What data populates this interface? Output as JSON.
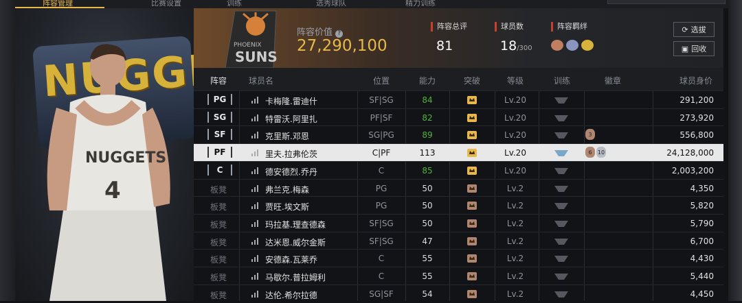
{
  "tabs": [
    "阵容管理",
    "比赛设置",
    "训练",
    "选秀球队",
    "精力训练"
  ],
  "team_logo_text": {
    "line1": "PHOENIX",
    "line2": "SUNS"
  },
  "lineup_value": {
    "label": "阵容价值",
    "value": "27,290,100"
  },
  "stats": {
    "rating": {
      "label": "阵容总评",
      "value": "81"
    },
    "roster": {
      "label": "球员数",
      "value": "18",
      "suffix": "/300"
    },
    "bond": {
      "label": "阵容羁绊"
    }
  },
  "buttons": {
    "select": "选拔",
    "recycle": "回收"
  },
  "columns": {
    "lineup": "阵容",
    "name": "球员名",
    "position": "位置",
    "ability": "能力",
    "breakthrough": "突破",
    "level": "等级",
    "training": "训练",
    "badge": "徽章",
    "price": "球员身价"
  },
  "colors": {
    "accent": "#e8b84a",
    "ability_green": "#4fb33a",
    "stat_red": "#c8402a"
  },
  "rows": [
    {
      "slot": "PG",
      "name": "卡梅隆.雷迪什",
      "position": "SF|SG",
      "ability": "84",
      "ability_green": true,
      "breakthrough": "gold",
      "level": "Lv.20",
      "badges": [],
      "price": "291,200"
    },
    {
      "slot": "SG",
      "name": "特雷沃.阿里扎",
      "position": "PF|SF",
      "ability": "82",
      "ability_green": true,
      "breakthrough": "gold",
      "level": "Lv.20",
      "badges": [],
      "price": "273,920"
    },
    {
      "slot": "SF",
      "name": "克里斯.邓恩",
      "position": "SG|PG",
      "ability": "89",
      "ability_green": true,
      "breakthrough": "gold",
      "level": "Lv.20",
      "badges": [
        "3"
      ],
      "price": "556,800"
    },
    {
      "slot": "PF",
      "name": "里夫.拉弗伦茨",
      "position": "C|PF",
      "ability": "113",
      "ability_green": false,
      "breakthrough": "gold",
      "level": "Lv.20",
      "badges": [
        "6",
        "10"
      ],
      "price": "24,128,000",
      "selected": true
    },
    {
      "slot": "C",
      "name": "德安德烈.乔丹",
      "position": "C",
      "ability": "85",
      "ability_green": true,
      "breakthrough": "gold",
      "level": "Lv.20",
      "badges": [],
      "price": "2,003,200"
    },
    {
      "slot": "板凳",
      "name": "弗兰克.梅森",
      "position": "PG",
      "ability": "50",
      "ability_green": false,
      "breakthrough": "1",
      "level": "Lv.2",
      "badges": [],
      "price": "4,350"
    },
    {
      "slot": "板凳",
      "name": "贾旺.埃文斯",
      "position": "PG",
      "ability": "50",
      "ability_green": false,
      "breakthrough": "1",
      "level": "Lv.2",
      "badges": [],
      "price": "5,820"
    },
    {
      "slot": "板凳",
      "name": "玛拉基.理查德森",
      "position": "SF|SG",
      "ability": "50",
      "ability_green": false,
      "breakthrough": "1",
      "level": "Lv.2",
      "badges": [],
      "price": "5,790"
    },
    {
      "slot": "板凳",
      "name": "达米恩.威尔金斯",
      "position": "SF|SG",
      "ability": "47",
      "ability_green": false,
      "breakthrough": "1",
      "level": "Lv.2",
      "badges": [],
      "price": "6,700"
    },
    {
      "slot": "板凳",
      "name": "安德森.瓦莱乔",
      "position": "C",
      "ability": "55",
      "ability_green": false,
      "breakthrough": "1",
      "level": "Lv.2",
      "badges": [],
      "price": "4,430"
    },
    {
      "slot": "板凳",
      "name": "马歇尔.普拉姆利",
      "position": "C",
      "ability": "55",
      "ability_green": false,
      "breakthrough": "1",
      "level": "Lv.2",
      "badges": [],
      "price": "5,440"
    },
    {
      "slot": "板凳",
      "name": "达伦.希尔拉德",
      "position": "SG|SF",
      "ability": "54",
      "ability_green": false,
      "breakthrough": "1",
      "level": "Lv.2",
      "badges": [],
      "price": "4,450"
    }
  ]
}
